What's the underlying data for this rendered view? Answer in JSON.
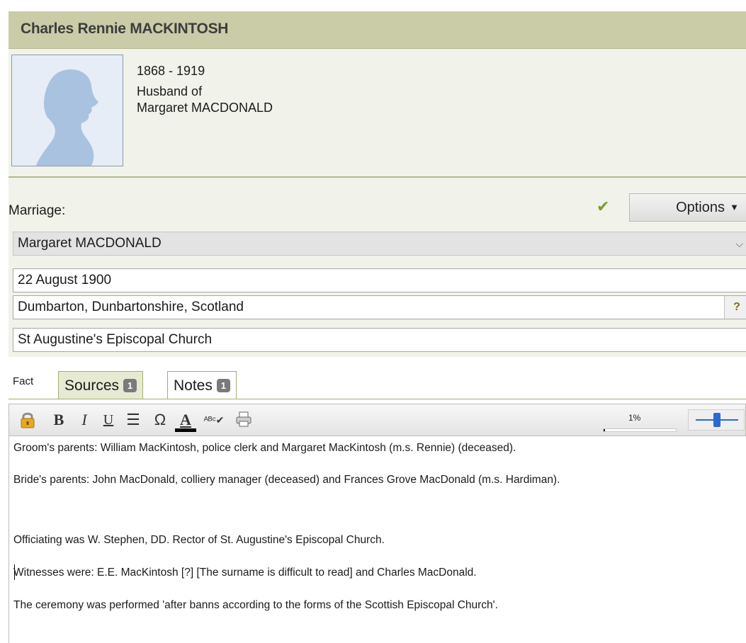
{
  "person": {
    "name": "Charles Rennie MACKINTOSH",
    "dates": "1868 - 1919",
    "relation_line1": "Husband of",
    "relation_line2": "Margaret MACDONALD"
  },
  "event": {
    "label": "Marriage:",
    "options_label": "Options",
    "spouse": "Margaret MACDONALD",
    "date": "22 August 1900",
    "place": "Dumbarton, Dunbartonshire, Scotland",
    "description": "St Augustine's Episcopal Church"
  },
  "tabs": {
    "fact_label": "Fact",
    "items": [
      {
        "label": "Sources",
        "count": "1",
        "active": false
      },
      {
        "label": "Notes",
        "count": "1",
        "active": true
      }
    ]
  },
  "toolbar": {
    "zoom_percent": "1%",
    "zoom_fraction": 0.01,
    "slider_fraction": 0.5
  },
  "notes": [
    "Groom's parents: William MacKintosh, police clerk and Margaret MacKintosh (m.s. Rennie) (deceased).",
    "Bride's parents: John MacDonald, colliery manager (deceased) and Frances Grove MacDonald (m.s. Hardiman).",
    "Officiating was W. Stephen, DD. Rector of St. Augustine's Episcopal Church.",
    "Witnesses were: E.E. MacKintosh [?] [The surname is difficult to read] and Charles MacDonald.",
    "The ceremony was performed 'after banns according to the forms of the Scottish Episcopal Church'."
  ],
  "colors": {
    "header_bg": "#c9cca7",
    "panel_bg": "#f1f2ea",
    "accent_check": "#7b9c2a",
    "slider_blue": "#2a6bd1"
  },
  "icons": {
    "photo": "silhouette-icon",
    "check": "checkmark-icon",
    "place": "globe-question-icon",
    "lock": "lock-icon",
    "list": "bullet-list-icon",
    "special_char": "omega-icon",
    "spell": "spell-check-icon",
    "print": "printer-icon"
  }
}
